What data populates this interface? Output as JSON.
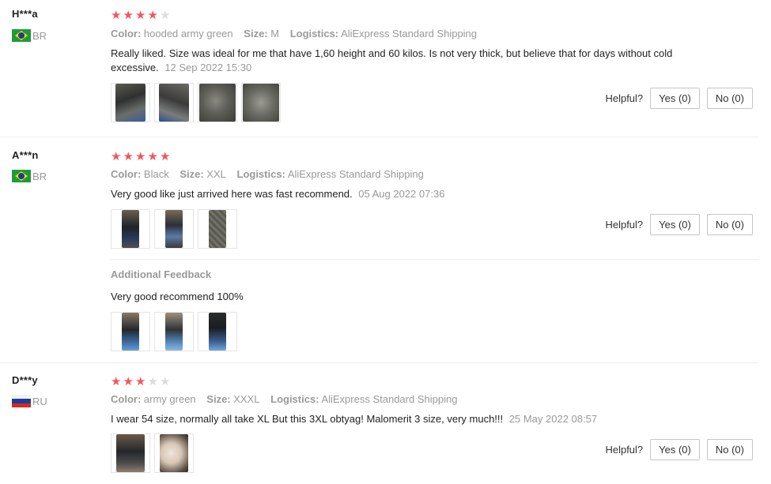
{
  "labels": {
    "color": "Color:",
    "size": "Size:",
    "logistics": "Logistics:",
    "helpful": "Helpful?",
    "additional_feedback": "Additional Feedback"
  },
  "colors": {
    "star_on": "#f2575e",
    "star_off": "#dcdcdc",
    "meta_text": "#999999"
  },
  "reviews": [
    {
      "user": "H***a",
      "country": "BR",
      "flag_icon": "brazil-flag-icon",
      "rating": 4,
      "color": "hooded army green",
      "size": "M",
      "logistics": "AliExpress Standard Shipping",
      "text": "Really liked. Size was ideal for me that have 1,60 height and 60 kilos. Is not very thick, but believe that for days without cold excessive.",
      "date": "12 Sep 2022 15:30",
      "photos": 4,
      "yes": "Yes (0)",
      "no": "No (0)"
    },
    {
      "user": "A***n",
      "country": "BR",
      "flag_icon": "brazil-flag-icon",
      "rating": 5,
      "color": "Black",
      "size": "XXL",
      "logistics": "AliExpress Standard Shipping",
      "text": "Very good like just arrived here was fast recommend.",
      "date": "05 Aug 2022 07:36",
      "photos": 3,
      "yes": "Yes (0)",
      "no": "No (0)",
      "additional_text": "Very good recommend 100%",
      "additional_photos": 3
    },
    {
      "user": "D***y",
      "country": "RU",
      "flag_icon": "russia-flag-icon",
      "rating": 3,
      "color": "army green",
      "size": "XXXL",
      "logistics": "AliExpress Standard Shipping",
      "text": "I wear 54 size, normally all take XL But this 3XL obtyag! Malomerit 3 size, very much!!!",
      "date": "25 May 2022 08:57",
      "photos": 2,
      "yes": "Yes (0)",
      "no": "No (0)"
    }
  ]
}
